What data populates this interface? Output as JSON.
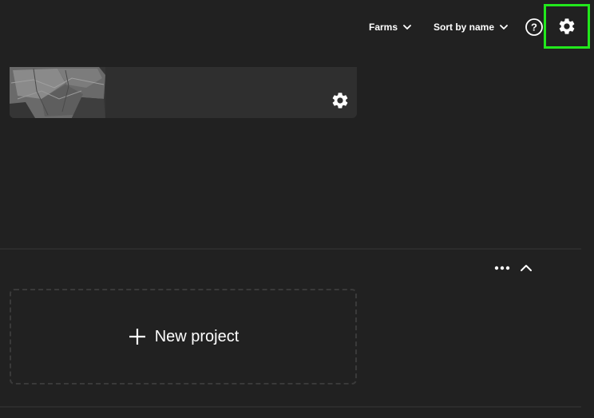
{
  "toolbar": {
    "farms_label": "Farms",
    "sort_label": "Sort by name",
    "help_symbol": "?"
  },
  "new_project": {
    "label": "New project"
  },
  "icons": {
    "farms_dropdown": "chevron-down-icon",
    "sort_dropdown": "chevron-down-icon",
    "help": "help-circle-icon",
    "settings": "gear-icon",
    "card_settings": "gear-icon",
    "more": "more-horizontal-icon",
    "collapse": "chevron-up-icon",
    "add": "plus-icon"
  },
  "colors": {
    "background": "#212121",
    "card": "#2f2f2f",
    "highlight": "#22e81c",
    "text": "#ffffff"
  }
}
